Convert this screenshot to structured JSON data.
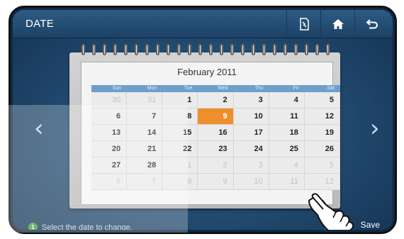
{
  "header": {
    "title": "DATE"
  },
  "icons": {
    "settings": "settings-icon",
    "home": "home-icon",
    "back": "back-icon"
  },
  "nav": {
    "prev": "‹",
    "next": "›"
  },
  "calendar": {
    "month_label": "February 2011",
    "weekdays": [
      "Sun",
      "Mon",
      "Tue",
      "Wed",
      "Thu",
      "Fri",
      "Sat"
    ],
    "weeks": [
      [
        "30",
        "31",
        "1",
        "2",
        "3",
        "4",
        "5"
      ],
      [
        "6",
        "7",
        "8",
        "9",
        "10",
        "11",
        "12"
      ],
      [
        "13",
        "14",
        "15",
        "16",
        "17",
        "18",
        "19"
      ],
      [
        "20",
        "21",
        "22",
        "23",
        "24",
        "25",
        "26"
      ],
      [
        "27",
        "28",
        "1",
        "2",
        "3",
        "4",
        "5"
      ],
      [
        "6",
        "7",
        "8",
        "9",
        "10",
        "11",
        "12"
      ]
    ],
    "selected": "9",
    "selected_color": "#ef8f2c"
  },
  "status": {
    "step": "1",
    "text": "Select the date to change."
  },
  "save_label": "Save",
  "colors": {
    "header": "#2d5b84",
    "accent": "#ef8f2c",
    "weekday_bar": "#6f9fcc"
  }
}
